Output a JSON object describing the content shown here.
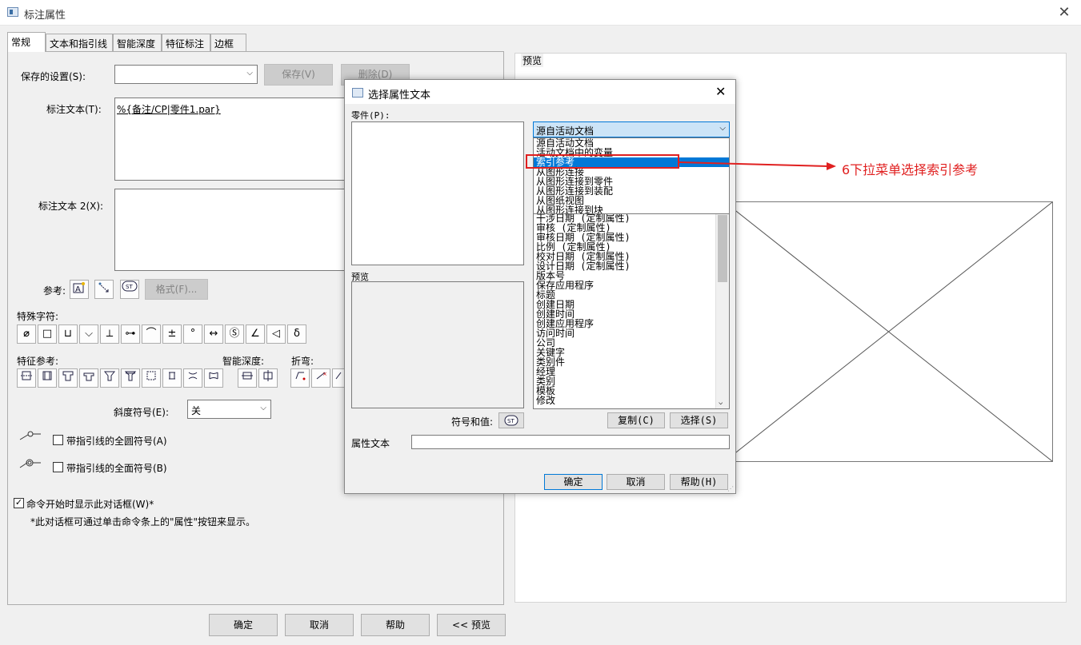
{
  "window": {
    "title": "标注属性",
    "close": "✕"
  },
  "tabs": [
    "常规",
    "文本和指引线",
    "智能深度",
    "特征标注",
    "边框"
  ],
  "general": {
    "saved_settings_label": "保存的设置(S):",
    "save_button": "保存(V)",
    "delete_button": "删除(D)",
    "callout_text_label": "标注文本(T):",
    "callout_text_value": "%{备注/CP|零件1.par}",
    "callout_text2_label": "标注文本 2(X):",
    "reference_label": "参考:",
    "format_button": "格式(F)...",
    "special_chars_label": "特殊字符:",
    "special_chars": [
      "⌀",
      "□",
      "⊔",
      "⌵",
      "⟂",
      "⊶",
      "⌒",
      "±",
      "°",
      "↔",
      "Ⓢ",
      "∠",
      "◁",
      "δ"
    ],
    "feature_ref_label": "特征参考:",
    "smart_depth_label": "智能深度:",
    "bend_label": "折弯:",
    "bevel_label": "斜度符号(E):",
    "bevel_value": "关",
    "all_around_label": "带指引线的全圆符号(A)",
    "all_over_label": "带指引线的全面符号(B)",
    "show_dialog_label": "命令开始时显示此对话框(W)*",
    "note": "*此对话框可通过单击命令条上的\"属性\"按钮来显示。"
  },
  "preview": {
    "label": "预览"
  },
  "bottom_buttons": {
    "ok": "确定",
    "cancel": "取消",
    "help": "帮助",
    "preview": "<< 预览"
  },
  "dialog": {
    "title": "选择属性文本",
    "close": "✕",
    "part_label": "零件(P):",
    "preview_label": "预览",
    "source_value": "源自活动文档",
    "dropdown_items": [
      "源自活动文档",
      "活动文档中的变量",
      "索引参考",
      "从图形连接",
      "从图形连接到零件",
      "从图形连接到装配",
      "从图纸视图",
      "从图形连接到块"
    ],
    "selected_index": 2,
    "list_items": [
      "干涉日期 (定制属性)",
      "审核 (定制属性)",
      "审核日期 (定制属性)",
      "比例 (定制属性)",
      "校对日期 (定制属性)",
      "设计日期 (定制属性)",
      "版本号",
      "保存应用程序",
      "标题",
      "创建日期",
      "创建时间",
      "创建应用程序",
      "访问时间",
      "公司",
      "关键字",
      "类别件",
      "经理",
      "类别",
      "模板",
      "修改"
    ],
    "symbol_label": "符号和值:",
    "copy_button": "复制(C)",
    "select_button": "选择(S)",
    "attr_text_label": "属性文本",
    "ok_button": "确定",
    "cancel_button": "取消",
    "help_button": "帮助(H)"
  },
  "annotation": {
    "text": "6下拉菜单选择索引参考",
    "color": "#e02020"
  }
}
